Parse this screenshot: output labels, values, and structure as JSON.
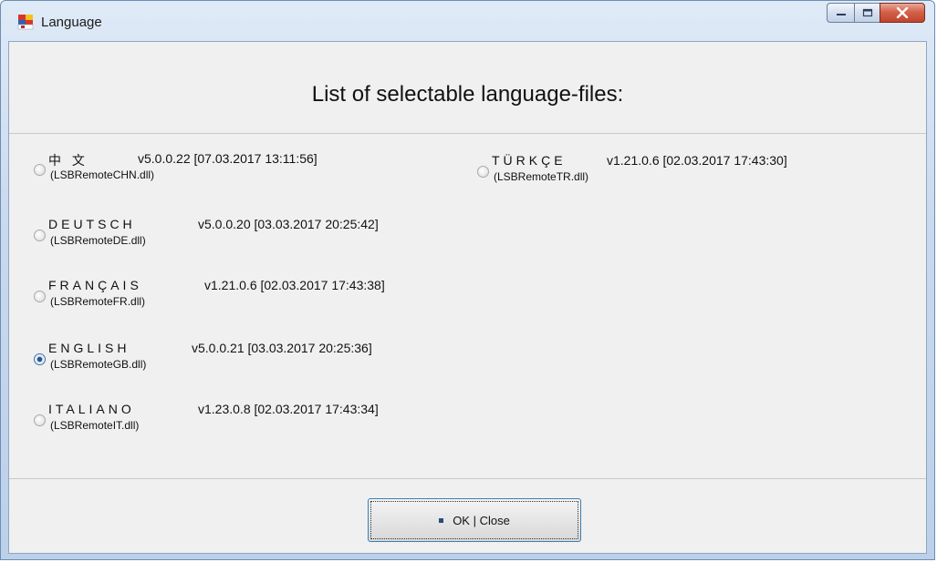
{
  "window": {
    "title": "Language",
    "icon": "app-flag-icon"
  },
  "header": {
    "title": "List of selectable language-files:"
  },
  "languages": [
    {
      "name": "中 文",
      "version": "v5.0.0.22 [07.03.2017 13:11:56]",
      "file": "(LSBRemoteCHN.dll)",
      "selected": false
    },
    {
      "name": "DEUTSCH",
      "version": "v5.0.0.20 [03.03.2017 20:25:42]",
      "file": "(LSBRemoteDE.dll)",
      "selected": false
    },
    {
      "name": "FRANÇAIS",
      "version": "v1.21.0.6 [02.03.2017 17:43:38]",
      "file": "(LSBRemoteFR.dll)",
      "selected": false
    },
    {
      "name": "ENGLISH",
      "version": "v5.0.0.21 [03.03.2017 20:25:36]",
      "file": "(LSBRemoteGB.dll)",
      "selected": true
    },
    {
      "name": "ITALIANO",
      "version": "v1.23.0.8 [02.03.2017 17:43:34]",
      "file": "(LSBRemoteIT.dll)",
      "selected": false
    },
    {
      "name": "TÜRKÇE",
      "version": "v1.21.0.6 [02.03.2017 17:43:30]",
      "file": "(LSBRemoteTR.dll)",
      "selected": false
    }
  ],
  "footer": {
    "ok_label": "OK | Close"
  },
  "colors": {
    "accent": "#3c7fb1",
    "close_button": "#c1442c"
  }
}
